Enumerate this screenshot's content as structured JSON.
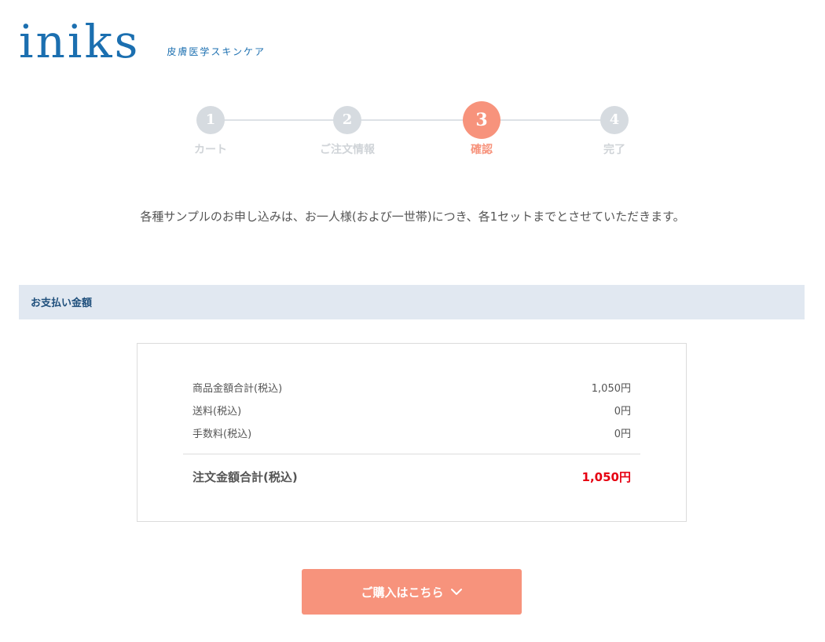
{
  "brand": {
    "logo": "iniks",
    "tagline": "皮膚医学スキンケア",
    "color": "#1b6fb0"
  },
  "steps": [
    {
      "number": "1",
      "label": "カート",
      "active": false
    },
    {
      "number": "2",
      "label": "ご注文情報",
      "active": false
    },
    {
      "number": "3",
      "label": "確認",
      "active": true
    },
    {
      "number": "4",
      "label": "完了",
      "active": false
    }
  ],
  "notice": "各種サンプルのお申し込みは、お一人様(および一世帯)につき、各1セットまでとさせていただきます。",
  "payment": {
    "section_title": "お支払い金額",
    "rows": [
      {
        "label": "商品金額合計(税込)",
        "value": "1,050円"
      },
      {
        "label": "送料(税込)",
        "value": "0円"
      },
      {
        "label": "手数料(税込)",
        "value": "0円"
      }
    ],
    "total_label": "注文金額合計(税込)",
    "total_value": "1,050円"
  },
  "purchase_button": {
    "label": "ご購入はこちら",
    "icon": "chevron-down-icon"
  },
  "colors": {
    "accent": "#f7937c",
    "total": "#e60012",
    "section_bg": "#e1e8f1",
    "inactive_step": "#d6dbe0"
  }
}
